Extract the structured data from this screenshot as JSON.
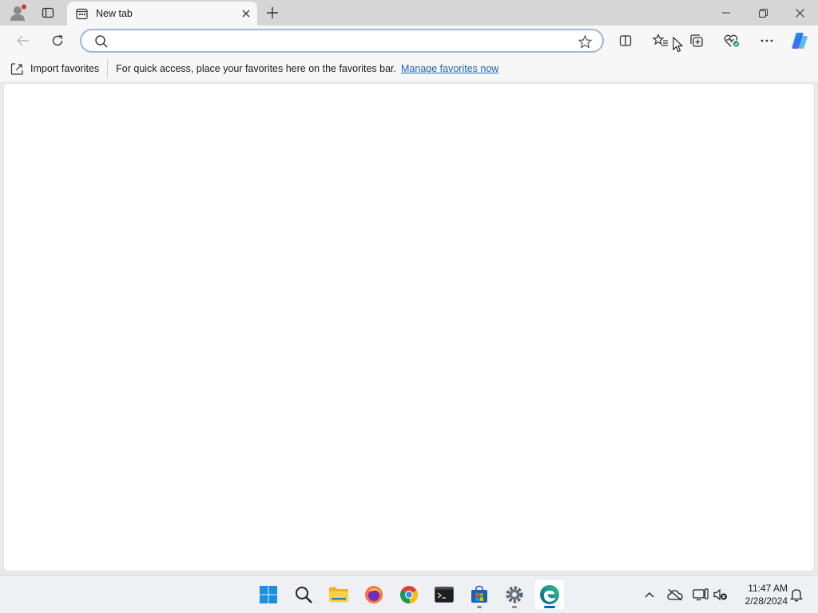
{
  "tab": {
    "title": "New tab"
  },
  "address_bar": {
    "value": "",
    "placeholder": ""
  },
  "favorites_bar": {
    "import_label": "Import favorites",
    "hint": "For quick access, place your favorites here on the favorites bar.",
    "manage_link": "Manage favorites now"
  },
  "taskbar": {
    "time": "11:47 AM",
    "date": "2/28/2024",
    "apps": [
      "start-icon",
      "search-icon",
      "file-explorer-icon",
      "firefox-icon",
      "chrome-icon",
      "terminal-icon",
      "store-icon",
      "settings-icon",
      "edge-icon"
    ]
  },
  "colors": {
    "accent": "#0067c0",
    "link": "#1a66b5",
    "address_border": "#9fb7d6",
    "notification_dot": "#d13438"
  }
}
